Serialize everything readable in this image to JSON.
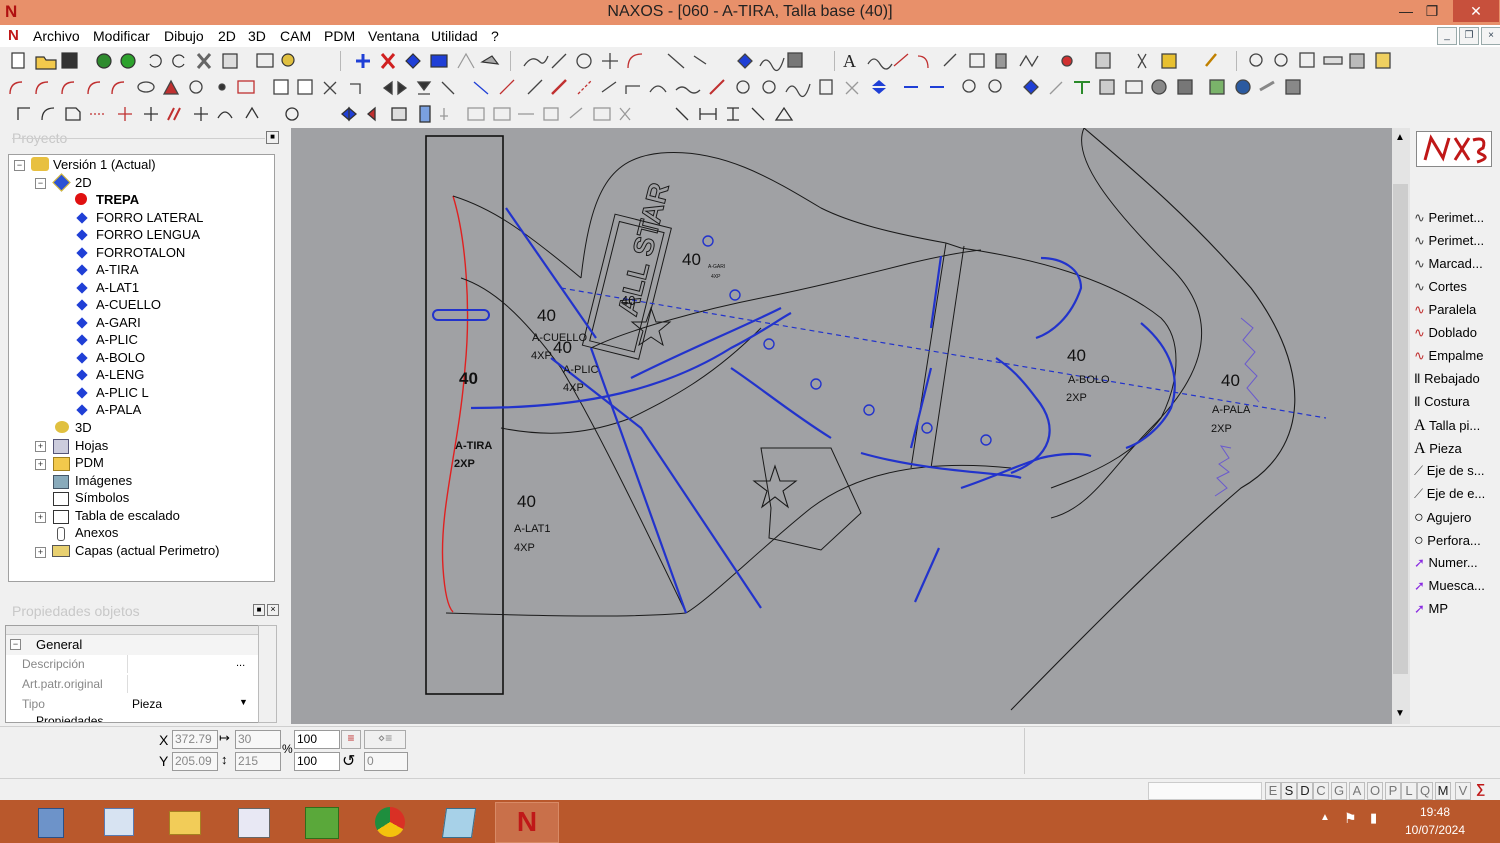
{
  "window": {
    "title": "NAXOS - [060 - A-TIRA, Talla base (40)]",
    "minimize_label": "—",
    "restore_label": "❐",
    "close_label": "✕"
  },
  "menu": {
    "items": [
      "Archivo",
      "Modificar",
      "Dibujo",
      "2D",
      "3D",
      "CAM",
      "PDM",
      "Ventana",
      "Utilidad",
      "?"
    ]
  },
  "project_panel": {
    "title": "Proyecto",
    "tree": {
      "root": "Versión 1 (Actual)",
      "node_2d": "2D",
      "pieces": [
        "TREPA",
        "FORRO LATERAL",
        "FORRO LENGUA",
        "FORROTALON",
        "A-TIRA",
        "A-LAT1",
        "A-CUELLO",
        "A-GARI",
        "A-PLIC",
        "A-BOLO",
        "A-LENG",
        "A-PLIC L",
        "A-PALA"
      ],
      "node_3d": "3D",
      "others": [
        "Hojas",
        "PDM",
        "Imágenes",
        "Símbolos",
        "Tabla de escalado",
        "Anexos",
        "Capas (actual Perimetro)"
      ]
    }
  },
  "properties_panel": {
    "title": "Propiedades objetos",
    "group": "General",
    "rows": [
      {
        "label": "Descripción",
        "value": "",
        "button": "..."
      },
      {
        "label": "Art.patr.original",
        "value": ""
      },
      {
        "label": "Tipo",
        "value": "Pieza"
      }
    ],
    "next_group": "Propiedades"
  },
  "canvas": {
    "labels": {
      "atira_size": "40",
      "atira_name": "A-TIRA",
      "atira_qty": "2XP",
      "alat1_size": "40",
      "alat1_name": "A-LAT1",
      "alat1_qty": "4XP",
      "acuello_size": "40",
      "acuello_name": "A-CUELLO",
      "acuello_qty": "4XP",
      "aplic_size": "40",
      "aplic_name": "A-PLIC",
      "aplic_qty": "4XP",
      "agari_size": "40",
      "agari2_size": "40",
      "agari_name": "A-GARI",
      "agari_qty": "4XP",
      "abolo_size": "40",
      "abolo_name": "A-BOLO",
      "abolo_qty": "2XP",
      "apala_size": "40",
      "apala_name": "A-PALA",
      "apala_qty": "2XP",
      "brand_text": "ALL STAR"
    },
    "colors": {
      "background": "#a0a1a4",
      "outline": "#1a1a1a",
      "stitch": "#2233cc",
      "selected": "#e02020"
    }
  },
  "right_tools": [
    "Perimet...",
    "Perimet...",
    "Marcad...",
    "Cortes",
    "Paralela",
    "Doblado",
    "Empalme",
    "Rebajado",
    "Costura",
    "Talla pi...",
    "Pieza",
    "Eje de s...",
    "Eje de e...",
    "Agujero",
    "Perfora...",
    "Numer...",
    "Muesca...",
    "MP"
  ],
  "coords": {
    "x_label": "X",
    "y_label": "Y",
    "x_value": "372.79",
    "y_value": "205.09",
    "width_value": "30",
    "height_value": "215",
    "scale_x": "100",
    "scale_y": "100",
    "rotation": "0",
    "percent_label": "%"
  },
  "status_letters": [
    "E",
    "S",
    "D",
    "C",
    "G",
    "A",
    "O",
    "P",
    "L",
    "Q",
    "M",
    "V"
  ],
  "taskbar": {
    "time": "19:48",
    "date": "10/07/2024"
  }
}
